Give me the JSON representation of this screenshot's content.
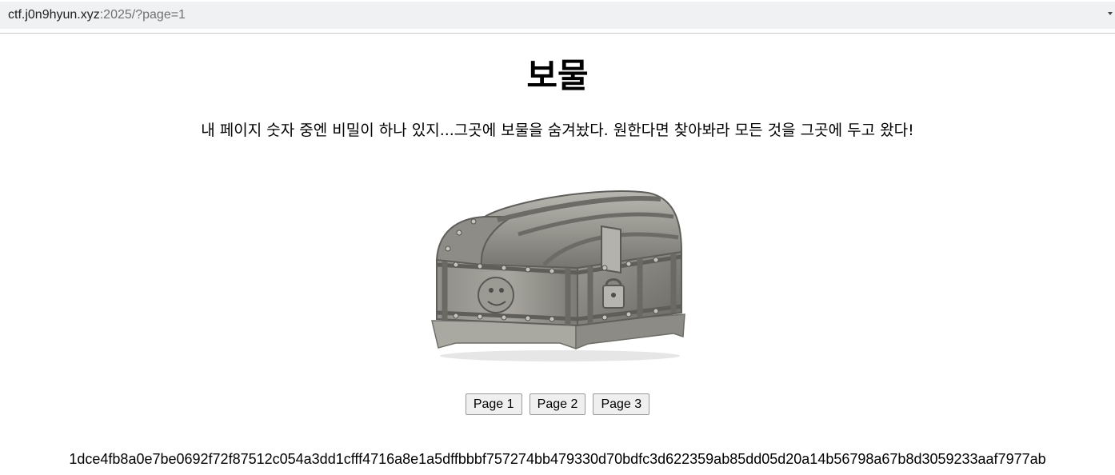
{
  "browser": {
    "url_host": "ctf.j0n9hyun.xyz",
    "url_rest": ":2025/?page=1"
  },
  "main": {
    "title": "보물",
    "intro": "내 페이지 숫자 중엔 비밀이 하나 있지...그곳에 보물을 숨겨놨다. 원한다면 찾아봐라 모든 것을 그곳에 두고 왔다!",
    "image_icon": "treasure-chest-icon",
    "pages": [
      {
        "label": "Page 1"
      },
      {
        "label": "Page 2"
      },
      {
        "label": "Page 3"
      }
    ],
    "hash": "1dce4fb8a0e7be0692f72f87512c054a3dd1cfff4716a8e1a5dffbbbf757274bb479330d70bdfc3d622359ab85dd05d20a14b56798a67b8d3059233aaf7977ab"
  }
}
